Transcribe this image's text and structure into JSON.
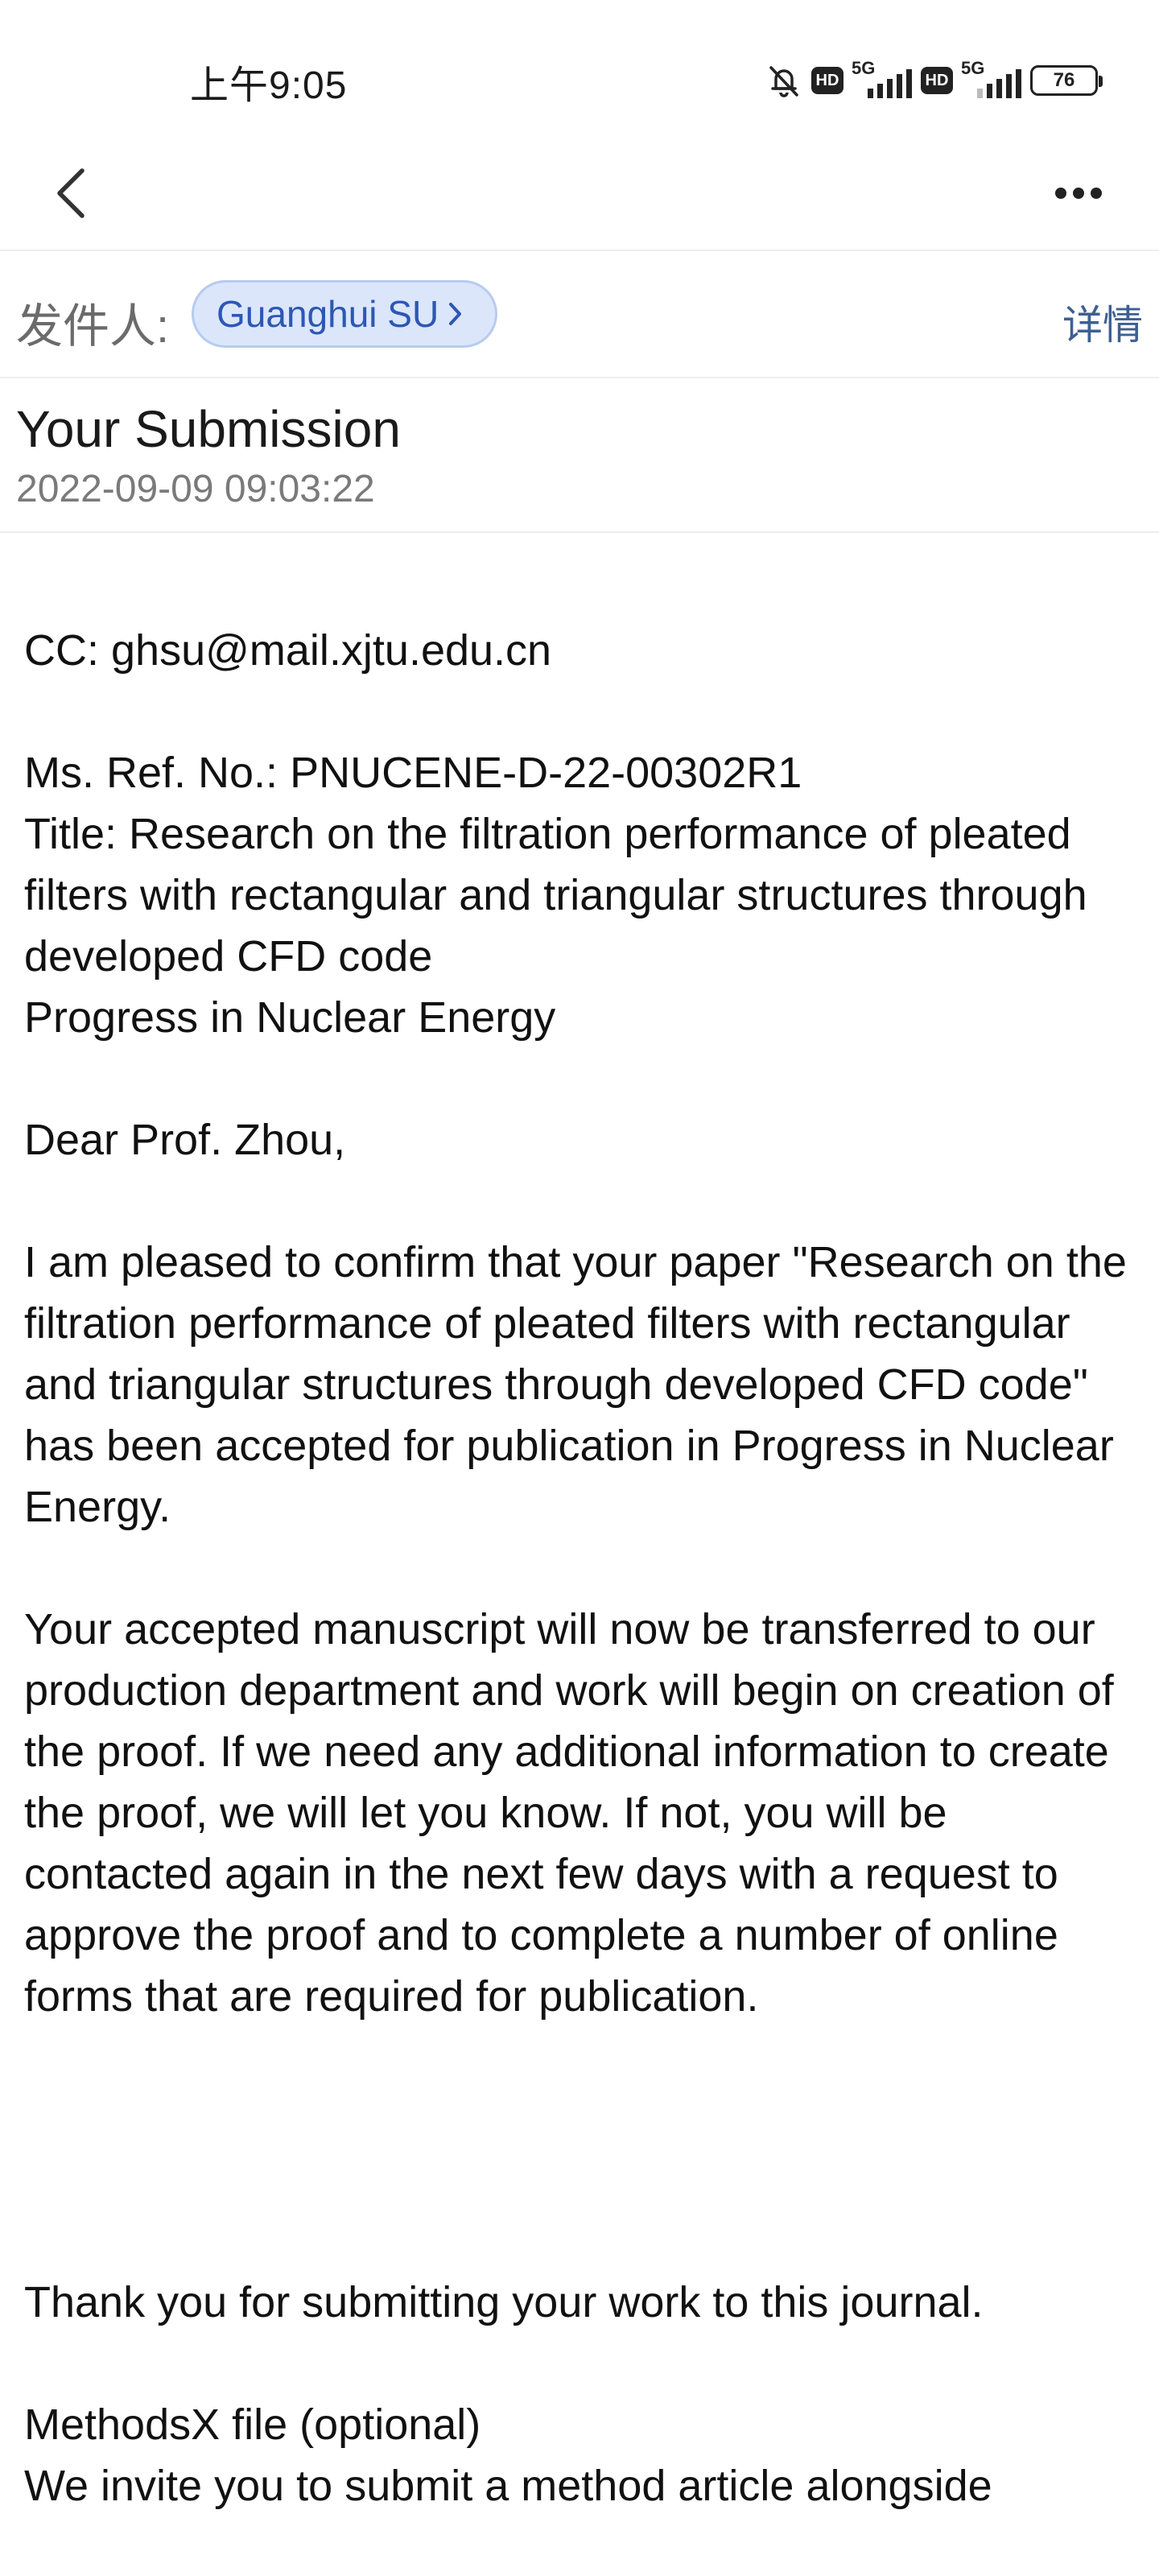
{
  "status_bar": {
    "time": "上午9:05",
    "sim1": {
      "network": "5G"
    },
    "sim2": {
      "network": "5G"
    },
    "hd": "HD",
    "battery": "76"
  },
  "nav": {
    "back_icon": "chevron-left-icon",
    "more_icon": "more-horizontal-icon"
  },
  "sender": {
    "label": "发件人:",
    "name": "Guanghui SU",
    "details": "详情"
  },
  "subject": {
    "title": "Your Submission",
    "datetime": "2022-09-09 09:03:22"
  },
  "body": {
    "cc": "CC: ghsu@mail.xjtu.edu.cn",
    "ref": "Ms. Ref. No.: PNUCENE-D-22-00302R1\nTitle: Research on the filtration performance of pleated filters with rectangular and triangular structures through developed CFD code\nProgress in Nuclear Energy",
    "greeting": "Dear Prof. Zhou,",
    "para1": "I am pleased to confirm that your paper \"Research on the filtration performance of pleated filters with rectangular and triangular structures through developed CFD code\" has been accepted for publication in Progress in Nuclear Energy.",
    "para2": "Your accepted manuscript will now be transferred to our production department and work will begin on creation of the proof. If we need any additional information to create the proof, we will let you know. If not, you will be contacted again in the next few days with a request to approve the proof and to complete a number of online forms that are required for publication.",
    "thanks": "Thank you for submitting your work to this journal.",
    "methodsx_title": "MethodsX file (optional)",
    "methodsx_text": "We invite you to submit a method article alongside"
  }
}
